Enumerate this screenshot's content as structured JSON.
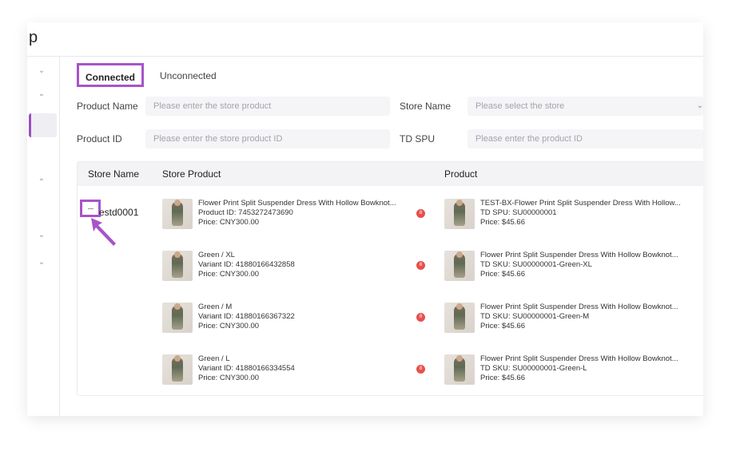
{
  "app": {
    "brand_fragment": "p"
  },
  "tabs": {
    "connected": "Connected",
    "unconnected": "Unconnected"
  },
  "filters": {
    "product_name_label": "Product Name",
    "product_name_placeholder": "Please enter the store product",
    "store_name_label": "Store Name",
    "store_name_placeholder": "Please select the store",
    "product_id_label": "Product ID",
    "product_id_placeholder": "Please enter the store product ID",
    "td_spu_label": "TD SPU",
    "td_spu_placeholder": "Please enter the product ID"
  },
  "table": {
    "headers": {
      "store_name": "Store Name",
      "store_product": "Store Product",
      "product": "Product"
    },
    "store_name_value": "estd0001",
    "rows": [
      {
        "store_title": "Flower Print Split Suspender Dress With Hollow Bowknot...",
        "store_id": "Product ID: 7453272473690",
        "store_price": "Price: CNY300.00",
        "badge": "8",
        "td_title": "TEST-BX-Flower Print Split Suspender Dress With Hollow...",
        "td_code": "TD SPU: SU00000001",
        "td_price": "Price: $45.66"
      },
      {
        "store_title": "Green / XL",
        "store_id": "Variant ID: 41880166432858",
        "store_price": "Price: CNY300.00",
        "badge": "8",
        "td_title": "Flower Print Split Suspender Dress With Hollow Bowknot...",
        "td_code": "TD SKU: SU00000001-Green-XL",
        "td_price": "Price: $45.66"
      },
      {
        "store_title": "Green / M",
        "store_id": "Variant ID: 41880166367322",
        "store_price": "Price: CNY300.00",
        "badge": "8",
        "td_title": "Flower Print Split Suspender Dress With Hollow Bowknot...",
        "td_code": "TD SKU: SU00000001-Green-M",
        "td_price": "Price: $45.66"
      },
      {
        "store_title": "Green / L",
        "store_id": "Variant ID: 41880166334554",
        "store_price": "Price: CNY300.00",
        "badge": "8",
        "td_title": "Flower Print Split Suspender Dress With Hollow Bowknot...",
        "td_code": "TD SKU: SU00000001-Green-L",
        "td_price": "Price: $45.66"
      }
    ]
  },
  "colors": {
    "accent": "#a854c8",
    "badge": "#e8504d",
    "input_bg": "#f5f5f8"
  }
}
